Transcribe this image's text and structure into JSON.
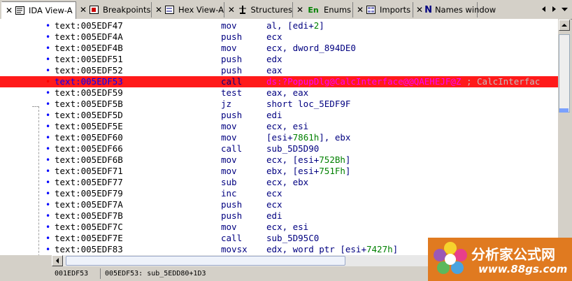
{
  "tabs": [
    {
      "label": "IDA View-A",
      "icon": "ida-view-icon",
      "active": true
    },
    {
      "label": "Breakpoints",
      "icon": "breakpoints-icon"
    },
    {
      "label": "Hex View-A",
      "icon": "hex-view-icon"
    },
    {
      "label": "Structures",
      "icon": "structures-icon"
    },
    {
      "label": "Enums",
      "icon": "enums-icon",
      "icon_text": "En"
    },
    {
      "label": "Imports",
      "icon": "imports-icon"
    },
    {
      "label": "Names window",
      "icon": "names-icon",
      "icon_text": "N"
    }
  ],
  "rows": [
    {
      "addr": "text:005EDF47",
      "mn": "mov",
      "op": [
        {
          "t": "al, [edi+"
        },
        {
          "t": "2",
          "c": "num"
        },
        {
          "t": "]"
        }
      ]
    },
    {
      "addr": "text:005EDF4A",
      "mn": "push",
      "op": [
        {
          "t": "ecx"
        }
      ]
    },
    {
      "addr": "text:005EDF4B",
      "mn": "mov",
      "op": [
        {
          "t": "ecx, dword_894DE0"
        }
      ]
    },
    {
      "addr": "text:005EDF51",
      "mn": "push",
      "op": [
        {
          "t": "edx"
        }
      ]
    },
    {
      "addr": "text:005EDF52",
      "mn": "push",
      "op": [
        {
          "t": "eax"
        }
      ]
    },
    {
      "addr": "text:005EDF53",
      "mn": "call",
      "highlight": true,
      "op": [
        {
          "t": "ds:",
          "c": "sym"
        },
        {
          "t": "?PopupDlg@CalcInterface@@QAEHEJF@Z",
          "c": "sym"
        },
        {
          "t": " ; CalcInterfac",
          "c": "cmt"
        }
      ]
    },
    {
      "addr": "text:005EDF59",
      "mn": "test",
      "op": [
        {
          "t": "eax, eax"
        }
      ]
    },
    {
      "addr": "text:005EDF5B",
      "mn": "jz",
      "op": [
        {
          "t": "short loc_5EDF9F"
        }
      ]
    },
    {
      "addr": "text:005EDF5D",
      "mn": "push",
      "op": [
        {
          "t": "edi"
        }
      ]
    },
    {
      "addr": "text:005EDF5E",
      "mn": "mov",
      "op": [
        {
          "t": "ecx, esi"
        }
      ]
    },
    {
      "addr": "text:005EDF60",
      "mn": "mov",
      "op": [
        {
          "t": "[esi+"
        },
        {
          "t": "7861h",
          "c": "num"
        },
        {
          "t": "], ebx"
        }
      ]
    },
    {
      "addr": "text:005EDF66",
      "mn": "call",
      "op": [
        {
          "t": "sub_5D5D90"
        }
      ]
    },
    {
      "addr": "text:005EDF6B",
      "mn": "mov",
      "op": [
        {
          "t": "ecx, [esi+"
        },
        {
          "t": "752Bh",
          "c": "num"
        },
        {
          "t": "]"
        }
      ]
    },
    {
      "addr": "text:005EDF71",
      "mn": "mov",
      "op": [
        {
          "t": "ebx, [esi+"
        },
        {
          "t": "751Fh",
          "c": "num"
        },
        {
          "t": "]"
        }
      ]
    },
    {
      "addr": "text:005EDF77",
      "mn": "sub",
      "op": [
        {
          "t": "ecx, ebx"
        }
      ]
    },
    {
      "addr": "text:005EDF79",
      "mn": "inc",
      "op": [
        {
          "t": "ecx"
        }
      ]
    },
    {
      "addr": "text:005EDF7A",
      "mn": "push",
      "op": [
        {
          "t": "ecx"
        }
      ]
    },
    {
      "addr": "text:005EDF7B",
      "mn": "push",
      "op": [
        {
          "t": "edi"
        }
      ]
    },
    {
      "addr": "text:005EDF7C",
      "mn": "mov",
      "op": [
        {
          "t": "ecx, esi"
        }
      ]
    },
    {
      "addr": "text:005EDF7E",
      "mn": "call",
      "op": [
        {
          "t": "sub_5D95C0"
        }
      ]
    },
    {
      "addr": "text:005EDF83",
      "mn": "movsx",
      "op": [
        {
          "t": "edx, word ptr [esi+"
        },
        {
          "t": "7427h",
          "c": "num"
        },
        {
          "t": "]"
        }
      ]
    }
  ],
  "status": {
    "offset": "001EDF53",
    "location": "005EDF53: sub_5EDD80+1D3"
  },
  "watermark": {
    "title": "分析家公式网",
    "url": "www.88gs.com"
  },
  "colors": {
    "highlight": "#ff1a1a",
    "symbol": "#ff00ff",
    "immediate": "#008000"
  }
}
